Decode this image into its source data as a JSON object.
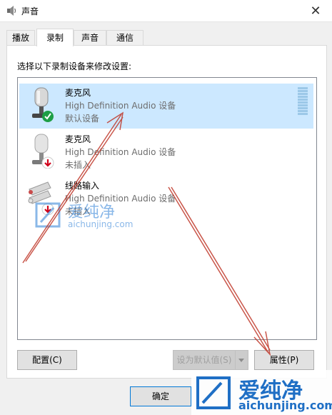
{
  "window": {
    "title": "声音",
    "close_glyph": "✕",
    "icon": "speaker-icon"
  },
  "tabs": [
    {
      "label": "播放",
      "active": false
    },
    {
      "label": "录制",
      "active": true
    },
    {
      "label": "声音",
      "active": false
    },
    {
      "label": "通信",
      "active": false
    }
  ],
  "panel": {
    "instruction": "选择以下录制设备来修改设置:"
  },
  "devices": [
    {
      "name": "麦克风",
      "description": "High Definition Audio 设备",
      "status": "默认设备",
      "selected": true,
      "badge": "green-check-icon"
    },
    {
      "name": "麦克风",
      "description": "High Definition Audio 设备",
      "status": "未插入",
      "selected": false,
      "badge": "red-down-arrow-icon"
    },
    {
      "name": "线路输入",
      "description": "High Definition Audio 设备",
      "status": "未插入",
      "selected": false,
      "badge": "red-down-arrow-icon"
    }
  ],
  "buttons": {
    "configure": "配置(C)",
    "set_default": "设为默认值(S)",
    "properties": "属性(P)",
    "ok": "确定"
  },
  "watermark": {
    "brand": "爱纯净",
    "url": "aichunjing.com"
  },
  "colors": {
    "selection": "#cce8ff",
    "accent": "#0078d7",
    "annotation_arrow": "#c0392b"
  }
}
